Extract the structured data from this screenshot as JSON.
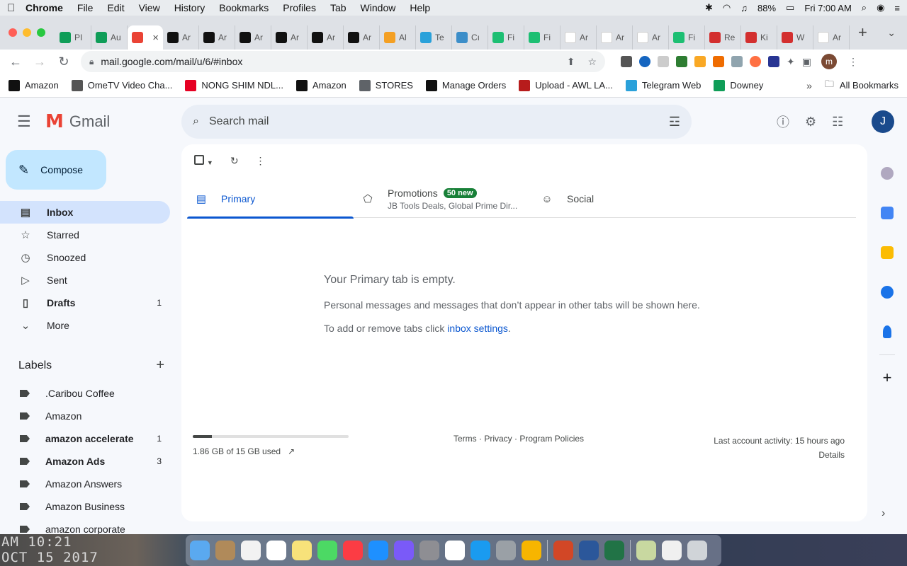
{
  "menubar": {
    "app": "Chrome",
    "items": [
      "File",
      "Edit",
      "View",
      "History",
      "Bookmarks",
      "Profiles",
      "Tab",
      "Window",
      "Help"
    ],
    "battery": "88%",
    "clock": "Fri 7:00 AM"
  },
  "tabs": [
    {
      "label": "PI",
      "icon": "sheets-icon",
      "color": "#0f9d58"
    },
    {
      "label": "Au",
      "icon": "sheets-icon",
      "color": "#0f9d58"
    },
    {
      "label": "",
      "icon": "gmail-icon",
      "color": "#ea4335",
      "active": true
    },
    {
      "label": "Ar",
      "icon": "amazon-icon",
      "color": "#111111"
    },
    {
      "label": "Ar",
      "icon": "amazon-icon",
      "color": "#111111"
    },
    {
      "label": "Ar",
      "icon": "amazon-icon",
      "color": "#111111"
    },
    {
      "label": "Ar",
      "icon": "amazon-icon",
      "color": "#111111"
    },
    {
      "label": "Ar",
      "icon": "amazon-icon",
      "color": "#111111"
    },
    {
      "label": "Ar",
      "icon": "amazon-icon",
      "color": "#111111"
    },
    {
      "label": "Al",
      "icon": "pencil-icon",
      "color": "#f4a024"
    },
    {
      "label": "Te",
      "icon": "telegram-icon",
      "color": "#2aa1da"
    },
    {
      "label": "Cı",
      "icon": "cloud-icon",
      "color": "#3c8ec9"
    },
    {
      "label": "Fi",
      "icon": "fiverr-icon",
      "color": "#1dbf73"
    },
    {
      "label": "Fi",
      "icon": "fiverr-icon",
      "color": "#1dbf73"
    },
    {
      "label": "Ar",
      "icon": "amazon-smile-icon",
      "color": "#ffffff"
    },
    {
      "label": "Ar",
      "icon": "amazon-smile-icon",
      "color": "#ffffff"
    },
    {
      "label": "Ar",
      "icon": "amazon-smile-icon",
      "color": "#ffffff"
    },
    {
      "label": "Fi",
      "icon": "fiverr-icon",
      "color": "#1dbf73"
    },
    {
      "label": "Re",
      "icon": "c-logo-icon",
      "color": "#d32f2f"
    },
    {
      "label": "Ki",
      "icon": "c-logo-icon",
      "color": "#d32f2f"
    },
    {
      "label": "W",
      "icon": "c-logo-icon",
      "color": "#d32f2f"
    },
    {
      "label": "Ar",
      "icon": "amazon-smile-icon",
      "color": "#ffffff"
    }
  ],
  "toolbar": {
    "url": "mail.google.com/mail/u/6/#inbox",
    "profile_initial": "m"
  },
  "bookmarks": [
    {
      "label": "Amazon",
      "icon": "amazon-icon",
      "color": "#111111"
    },
    {
      "label": "OmeTV Video Cha...",
      "icon": "ometv-icon",
      "color": "#555555"
    },
    {
      "label": "NONG SHIM NDL...",
      "icon": "pinterest-icon",
      "color": "#e60023"
    },
    {
      "label": "Amazon",
      "icon": "amazon-icon",
      "color": "#111111"
    },
    {
      "label": "STORES",
      "icon": "folder-icon",
      "color": "#5f6368"
    },
    {
      "label": "Manage Orders",
      "icon": "amazon-icon",
      "color": "#111111"
    },
    {
      "label": "Upload - AWL LA...",
      "icon": "awl-icon",
      "color": "#b71c1c"
    },
    {
      "label": "Telegram Web",
      "icon": "telegram-icon",
      "color": "#2aa1da"
    },
    {
      "label": "Downey",
      "icon": "sheets-icon",
      "color": "#0f9d58"
    }
  ],
  "bookmarks_more": "»",
  "all_bookmarks": "All Bookmarks",
  "gmail": {
    "product": "Gmail",
    "search_placeholder": "Search mail",
    "account_initial": "J",
    "compose": "Compose",
    "nav": [
      {
        "label": "Inbox",
        "icon": "inbox-icon",
        "count": "",
        "active": true,
        "bold": true
      },
      {
        "label": "Starred",
        "icon": "star-icon",
        "count": ""
      },
      {
        "label": "Snoozed",
        "icon": "clock-icon",
        "count": ""
      },
      {
        "label": "Sent",
        "icon": "send-icon",
        "count": ""
      },
      {
        "label": "Drafts",
        "icon": "draft-icon",
        "count": "1",
        "bold": true
      },
      {
        "label": "More",
        "icon": "chevron-down-icon",
        "count": ""
      }
    ],
    "labels_title": "Labels",
    "labels": [
      {
        "label": ".Caribou Coffee",
        "count": "",
        "bold": false
      },
      {
        "label": "Amazon",
        "count": "",
        "bold": false
      },
      {
        "label": "amazon accelerate",
        "count": "1",
        "bold": true
      },
      {
        "label": "Amazon Ads",
        "count": "3",
        "bold": true
      },
      {
        "label": "Amazon Answers",
        "count": "",
        "bold": false
      },
      {
        "label": "Amazon Business",
        "count": "",
        "bold": false
      },
      {
        "label": "amazon corporate",
        "count": "",
        "bold": false
      }
    ],
    "tabs": {
      "primary": "Primary",
      "promotions": "Promotions",
      "promotions_badge": "50 new",
      "promotions_sub": "JB Tools Deals, Global Prime Dir...",
      "social": "Social"
    },
    "empty": {
      "title": "Your Primary tab is empty.",
      "desc": "Personal messages and messages that don’t appear in other tabs will be shown here.",
      "note_prefix": "To add or remove tabs click ",
      "note_link": "inbox settings",
      "note_suffix": "."
    },
    "storage": {
      "text": "1.86 GB of 15 GB used",
      "used_fraction": 0.124
    },
    "footer_links": "Terms · Privacy · Program Policies",
    "last_activity": "Last account activity: 15 hours ago",
    "details": "Details"
  },
  "desktop_clock_line1": "AM 10:21",
  "desktop_clock_line2": "OCT 15 2017",
  "dock_apps": [
    "finder-icon",
    "contacts-icon",
    "reminders-icon",
    "calendar-icon",
    "notes-icon",
    "facetime-icon",
    "music-icon",
    "app-store-icon",
    "siri-icon",
    "system-preferences-icon",
    "chrome-icon",
    "safari-icon",
    "launchpad-icon",
    "photos-icon",
    "powerpoint-icon",
    "word-icon",
    "excel-icon",
    "preview-icon",
    "documents-icon",
    "trash-icon"
  ]
}
